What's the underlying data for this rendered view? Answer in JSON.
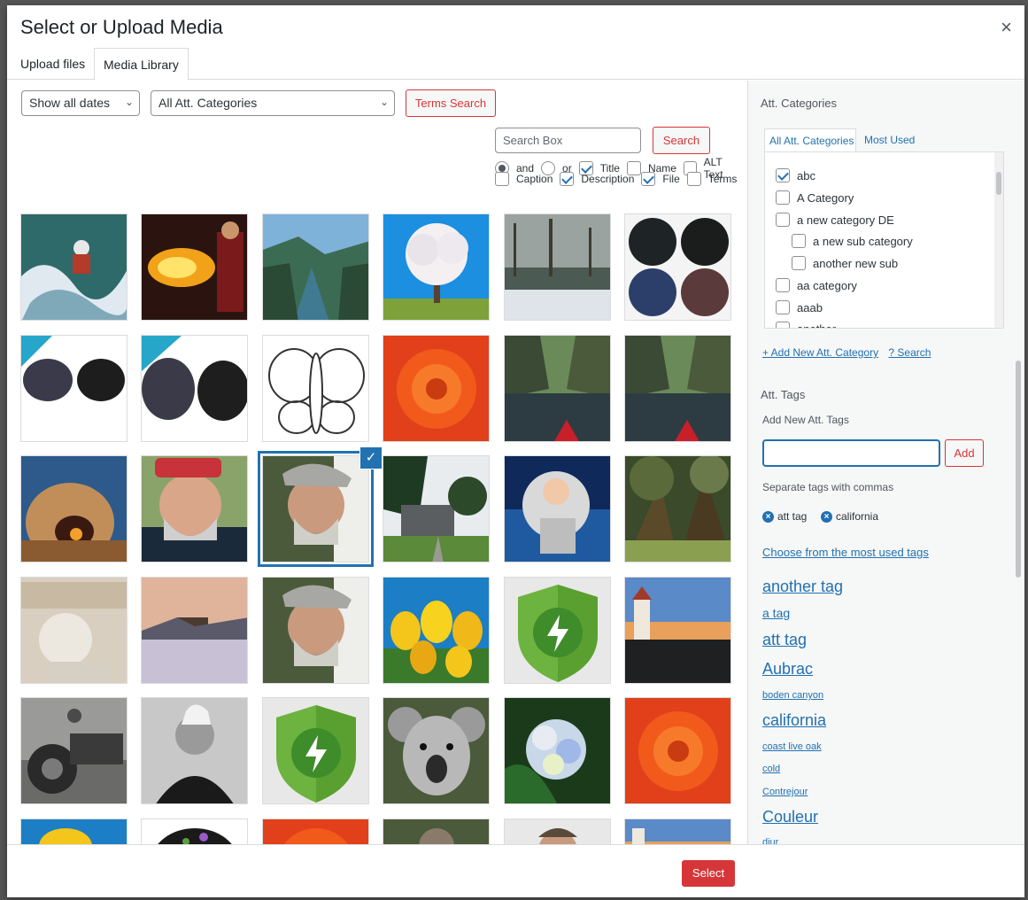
{
  "modal": {
    "title": "Select or Upload Media",
    "close": "×"
  },
  "tabs": [
    {
      "label": "Upload files"
    },
    {
      "label": "Media Library"
    }
  ],
  "filters": {
    "dates": "Show all dates",
    "categories": "All Att. Categories",
    "terms_search": "Terms Search"
  },
  "search": {
    "placeholder": "Search Box",
    "button": "Search",
    "options_row1": [
      "and",
      "or",
      "Title",
      "Name",
      "ALT Text"
    ],
    "options_row2": [
      "Caption",
      "Description",
      "File",
      "Terms"
    ]
  },
  "sidebar": {
    "categories_title": "Att. Categories",
    "cat_tab_all": "All Att. Categories",
    "cat_tab_used": "Most Used",
    "categories": [
      {
        "label": "abc",
        "checked": true
      },
      {
        "label": "A Category",
        "checked": false
      },
      {
        "label": "a new category DE",
        "checked": false
      },
      {
        "label": "a new sub category",
        "checked": false
      },
      {
        "label": "another new sub",
        "checked": false
      },
      {
        "label": "aa category",
        "checked": false
      },
      {
        "label": "aaab",
        "checked": false
      },
      {
        "label": "another",
        "checked": false
      }
    ],
    "add_category": "+ Add New Att. Category",
    "search_link": "? Search",
    "tags_title": "Att. Tags",
    "add_tags_label": "Add New Att. Tags",
    "add_button": "Add",
    "separate_hint": "Separate tags with commas",
    "chips": [
      "att tag",
      "california"
    ],
    "most_used_link": "Choose from the most used tags",
    "tag_cloud": [
      {
        "label": "another tag"
      },
      {
        "label": "a tag"
      },
      {
        "label": "att tag"
      },
      {
        "label": "Aubrac"
      },
      {
        "label": "boden canyon"
      },
      {
        "label": "california"
      },
      {
        "label": "coast live oak"
      },
      {
        "label": "cold"
      },
      {
        "label": "Contrejour"
      },
      {
        "label": "Couleur"
      },
      {
        "label": "djur"
      }
    ]
  },
  "footer": {
    "select": "Select"
  }
}
